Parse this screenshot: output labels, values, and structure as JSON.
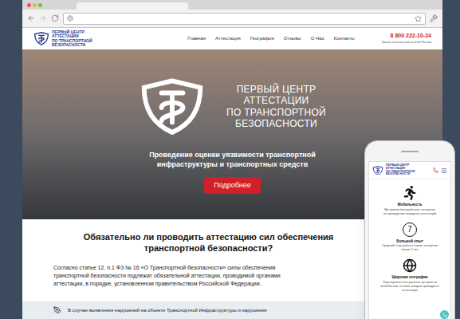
{
  "site": {
    "logo_lines": [
      "ПЕРВЫЙ ЦЕНТР",
      "АТТЕСТАЦИИ",
      "ПО ТРАНСПОРТНОЙ",
      "БЕЗОПАСНОСТИ"
    ],
    "nav": [
      "Главная",
      "Аттестация",
      "География",
      "Отзывы",
      "О Нас",
      "Контакты"
    ],
    "phone": "8 800 222-10-24",
    "phone_note": "Звонок бесплатный по всей России"
  },
  "hero": {
    "title_lines": [
      "ПЕРВЫЙ ЦЕНТР",
      "АТТЕСТАЦИИ",
      "ПО ТРАНСПОРТНОЙ",
      "БЕЗОПАСНОСТИ"
    ],
    "subtitle_lines": [
      "Проведение оценки уязвимости транспортной",
      "инфраструктуры и транспортных средств"
    ],
    "button": "Подробнее"
  },
  "question": {
    "title_lines": [
      "Обязательно ли проводить аттестацию сил обеспечения",
      "транспортной безопасности?"
    ],
    "text_lines": [
      "Согласно статье 12. п.1 ФЗ № 16 «О Транспортной безопасности» силы обеспечения",
      "транспортной безопасности подлежат обязательной аттестации, проводимой органами",
      "аттестации, в порядке, установленном правительством Российской Федерации."
    ]
  },
  "notice": "В случае выявления нарушений на объекте Транспортной Инфраструктуры и нарушения",
  "mobile": {
    "logo_lines": [
      "ПЕРВЫЙ ЦЕНТР",
      "АТТЕСТАЦИИ",
      "ПО ТРАНСПОРТНОЙ",
      "БЕЗОПАСНОСТИ"
    ],
    "features": [
      {
        "kind": "runner",
        "badge": "",
        "title": "Мобильность",
        "text_lines": [
          "Мы имеем большой штат экспертов",
          "по проведению выездных аттестаций"
        ]
      },
      {
        "kind": "number",
        "badge": "7",
        "title": "Большой опыт",
        "text_lines": [
          "Средний стаж работы наших экспертов",
          "более 7 лет"
        ]
      },
      {
        "kind": "globe",
        "badge": "",
        "title": "Широкая география",
        "text_lines": [
          "Партнерская сеть учебных центров по",
          "всей России, на базе которых проводится",
          "аттестация"
        ]
      }
    ]
  }
}
